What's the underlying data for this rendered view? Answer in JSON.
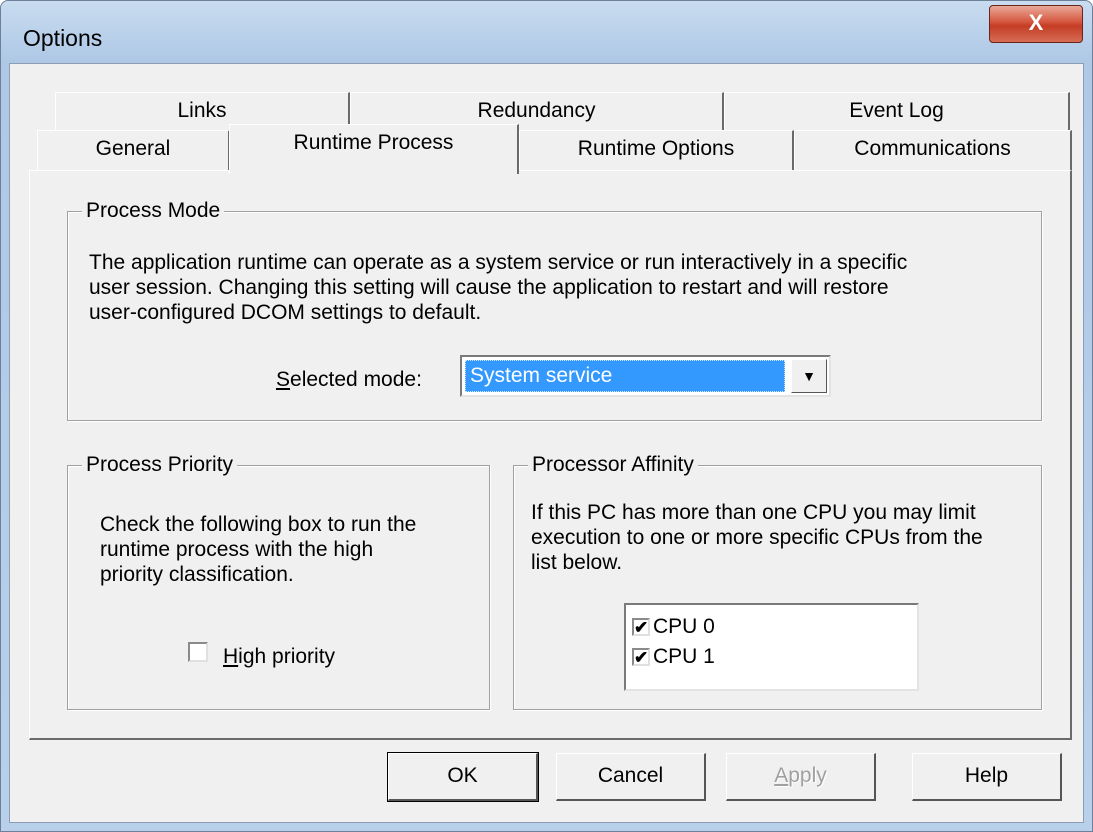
{
  "window": {
    "title": "Options",
    "close_glyph": "X"
  },
  "tabs": {
    "row1": [
      {
        "label": "Links"
      },
      {
        "label": "Redundancy"
      },
      {
        "label": "Event Log"
      }
    ],
    "row2": [
      {
        "label": "General"
      },
      {
        "label": "Runtime Process",
        "active": true
      },
      {
        "label": "Runtime Options"
      },
      {
        "label": "Communications"
      }
    ]
  },
  "process_mode": {
    "title": "Process Mode",
    "description_lines": [
      "The application runtime can operate as a system service or run interactively in a specific",
      "user session. Changing this setting will cause the application to restart and will restore",
      "user-configured DCOM settings to default."
    ],
    "selected_mode_label_underlined": "S",
    "selected_mode_label_rest": "elected mode:",
    "selected_mode_value": "System service"
  },
  "process_priority": {
    "title": "Process Priority",
    "description_lines": [
      "Check the following box to run the",
      "runtime process with the high",
      "priority classification."
    ],
    "checkbox_label_underlined": "H",
    "checkbox_label_rest": "igh priority",
    "checked": false
  },
  "processor_affinity": {
    "title": "Processor Affinity",
    "description_lines": [
      "If this PC has more than one CPU you may limit",
      "execution to one or more specific CPUs from the",
      "list below."
    ],
    "cpus": [
      {
        "label": "CPU 0",
        "checked": true
      },
      {
        "label": "CPU 1",
        "checked": true
      }
    ]
  },
  "buttons": {
    "ok": "OK",
    "cancel": "Cancel",
    "apply_underlined": "A",
    "apply_rest": "pply",
    "help": "Help"
  },
  "icons": {
    "check": "✔",
    "dropdown": "▼"
  }
}
